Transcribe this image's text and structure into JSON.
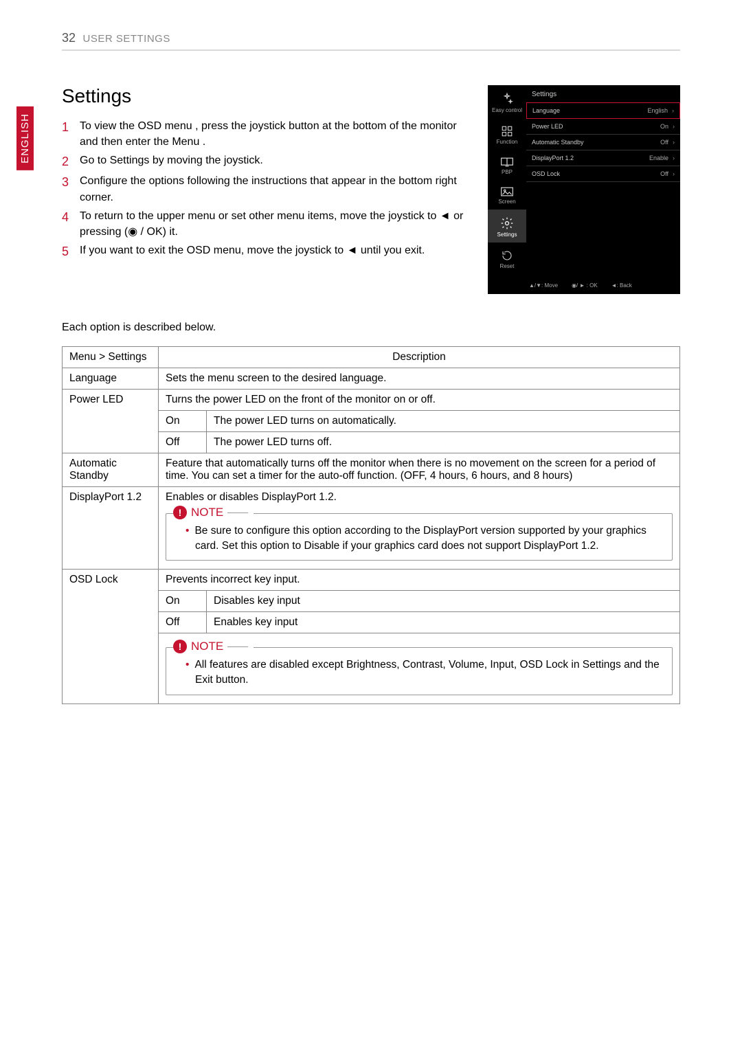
{
  "header": {
    "page_number": "32",
    "section": "USER SETTINGS"
  },
  "language_tab": "ENGLISH",
  "title": "Settings",
  "steps": [
    "To view the OSD menu , press the joystick button   at the bottom of the monitor and then enter the Menu .",
    "Go to Settings  by moving the joystick.",
    "Configure the options following the instructions that appear in the bottom right corner.",
    "To return to the upper menu or set other menu items, move the joystick to ◄ or pressing (◉ / OK) it.",
    "If you want to exit the OSD menu, move the joystick to ◄ until you exit."
  ],
  "osd": {
    "title": "Settings",
    "tabs": [
      {
        "label": "Easy control"
      },
      {
        "label": "Function"
      },
      {
        "label": "PBP"
      },
      {
        "label": "Screen"
      },
      {
        "label": "Settings"
      },
      {
        "label": "Reset"
      }
    ],
    "rows": [
      {
        "label": "Language",
        "value": "English"
      },
      {
        "label": "Power LED",
        "value": "On"
      },
      {
        "label": "Automatic Standby",
        "value": "Off"
      },
      {
        "label": "DisplayPort 1.2",
        "value": "Enable"
      },
      {
        "label": "OSD Lock",
        "value": "Off"
      }
    ],
    "footer": {
      "move": "▲/▼: Move",
      "ok": "◉/ ► : OK",
      "back": "◄: Back"
    }
  },
  "subdesc": "Each option is described below.",
  "table": {
    "head": {
      "menu": "Menu > Settings",
      "desc": "Description"
    },
    "language": {
      "label": "Language",
      "desc": "Sets the menu screen to the desired language."
    },
    "powerled": {
      "label": "Power LED",
      "desc": "Turns the power LED on the front of the monitor on or off.",
      "on_label": "On",
      "on_desc": "The power LED turns on automatically.",
      "off_label": "Off",
      "off_desc": "The power LED turns off."
    },
    "autostandby": {
      "label": "Automatic Standby",
      "desc": "Feature that automatically turns off the monitor when there is no movement on the screen for a period of time. You can set a timer for the auto-off function. (OFF, 4 hours, 6 hours, and 8 hours)"
    },
    "displayport": {
      "label": "DisplayPort 1.2",
      "desc": "Enables or disables DisplayPort 1.2.",
      "note_title": "NOTE",
      "note_body": "Be sure to configure this option according to the DisplayPort version supported by your graphics card. Set this option to Disable if your graphics card does not support DisplayPort 1.2."
    },
    "osdlock": {
      "label": "OSD Lock",
      "desc": "Prevents incorrect key input.",
      "on_label": "On",
      "on_desc": "Disables key input",
      "off_label": "Off",
      "off_desc": "Enables key input",
      "note_title": "NOTE",
      "note_body": "All features are disabled except Brightness, Contrast, Volume, Input, OSD Lock in Settings and the Exit button."
    }
  }
}
